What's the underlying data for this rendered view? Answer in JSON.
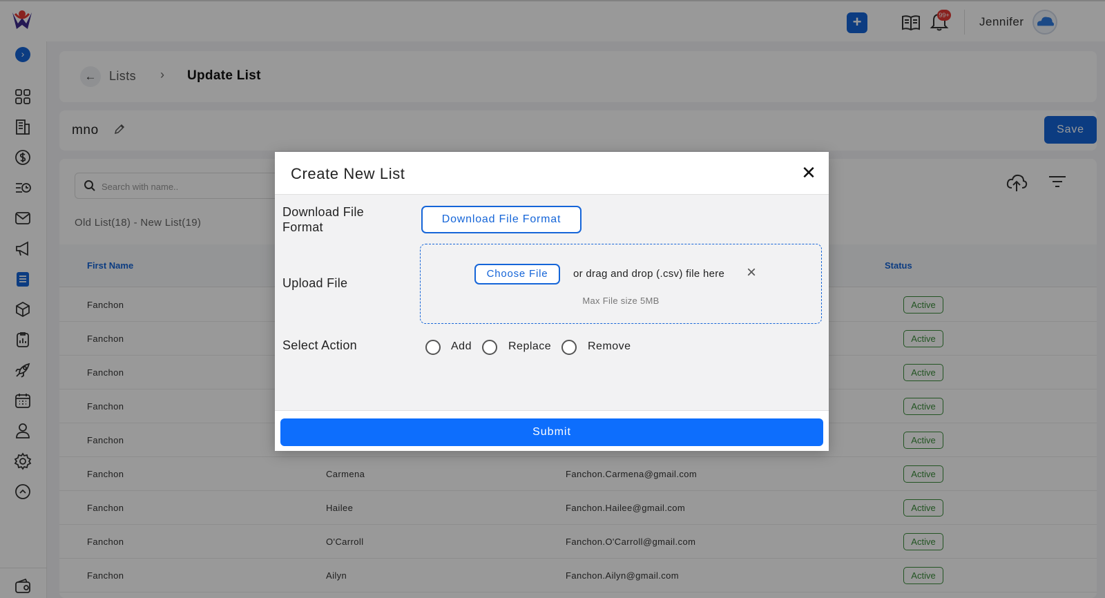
{
  "header": {
    "user_name": "Jennifer",
    "notification_badge": "99+",
    "add_label": "+"
  },
  "sidebar": {
    "icons": [
      "expand-icon",
      "dashboard-icon",
      "building-icon",
      "dollar-icon",
      "list-clock-icon",
      "mail-icon",
      "megaphone-icon",
      "clipboard-list-icon",
      "box-icon",
      "report-icon",
      "rocket-icon",
      "calendar-icon",
      "user-icon",
      "gear-icon",
      "chevron-up-circle-icon",
      "wallet-icon"
    ],
    "active": "clipboard-list-icon"
  },
  "breadcrumb": {
    "parent": "Lists",
    "current": "Update List"
  },
  "list": {
    "name": "mno",
    "save_label": "Save"
  },
  "table": {
    "search_placeholder": "Search with name..",
    "counts": "Old List(18) - New List(19)",
    "headers": {
      "first_name": "First Name",
      "status": "Status"
    },
    "rows": [
      {
        "first": "Fanchon",
        "last": "",
        "email": "",
        "status": "Active"
      },
      {
        "first": "Fanchon",
        "last": "",
        "email": "",
        "status": "Active"
      },
      {
        "first": "Fanchon",
        "last": "",
        "email": "",
        "status": "Active"
      },
      {
        "first": "Fanchon",
        "last": "",
        "email": "",
        "status": "Active"
      },
      {
        "first": "Fanchon",
        "last": "",
        "email": "",
        "status": "Active"
      },
      {
        "first": "Fanchon",
        "last": "Carmena",
        "email": "Fanchon.Carmena@gmail.com",
        "status": "Active"
      },
      {
        "first": "Fanchon",
        "last": "Hailee",
        "email": "Fanchon.Hailee@gmail.com",
        "status": "Active"
      },
      {
        "first": "Fanchon",
        "last": "O'Carroll",
        "email": "Fanchon.O'Carroll@gmail.com",
        "status": "Active"
      },
      {
        "first": "Fanchon",
        "last": "Ailyn",
        "email": "Fanchon.Ailyn@gmail.com",
        "status": "Active"
      }
    ]
  },
  "modal": {
    "title": "Create New List",
    "download_label": "Download File Format",
    "download_button": "Download File Format",
    "upload_label": "Upload File",
    "choose_file": "Choose File",
    "drop_text": "or drag and drop (.csv) file here",
    "max_size": "Max File size 5MB",
    "action_label": "Select Action",
    "actions": [
      "Add",
      "Replace",
      "Remove"
    ],
    "submit": "Submit"
  },
  "colors": {
    "accent": "#1565d8",
    "submit": "#0d6efd",
    "status_active": "#3a8c3a"
  }
}
